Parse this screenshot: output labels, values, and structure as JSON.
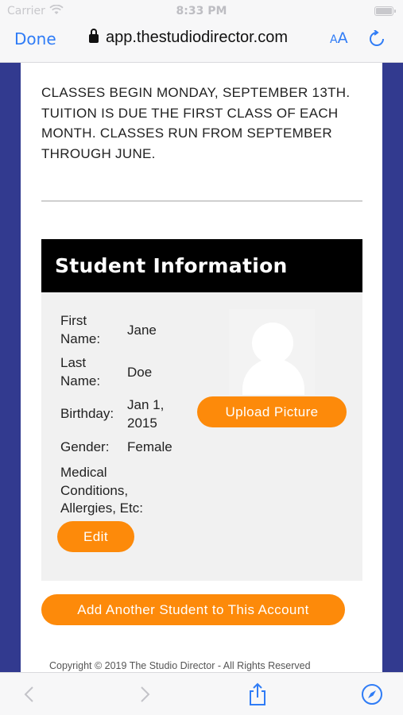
{
  "status": {
    "carrier": "Carrier",
    "time": "8:33 PM"
  },
  "browser": {
    "done_label": "Done",
    "url": "app.thestudiodirector.com",
    "text_size_label": "AA",
    "accent": "#2f7cf6"
  },
  "page": {
    "notice": "CLASSES BEGIN MONDAY, SEPTEMBER 13TH. TUITION IS DUE THE FIRST CLASS OF EACH MONTH. CLASSES RUN FROM SEPTEMBER THROUGH JUNE.",
    "section_title": "Student Information",
    "fields": [
      {
        "label": "First Name:",
        "value": "Jane"
      },
      {
        "label": "Last Name:",
        "value": "Doe"
      },
      {
        "label": "Birthday:",
        "value": "Jan 1, 2015"
      },
      {
        "label": "Gender:",
        "value": "Female"
      },
      {
        "label": "Medical Conditions, Allergies, Etc:",
        "value": ""
      }
    ],
    "upload_button": "Upload Picture",
    "edit_button": "Edit",
    "add_student_button": "Add Another Student to This Account",
    "copyright": "Copyright © 2019 The Studio Director - All Rights Reserved",
    "button_color": "#fd8a0a",
    "sidebar_color": "#323a8f"
  },
  "toolbar": {
    "icons": [
      "back-icon",
      "forward-icon",
      "share-icon",
      "compass-icon"
    ]
  }
}
